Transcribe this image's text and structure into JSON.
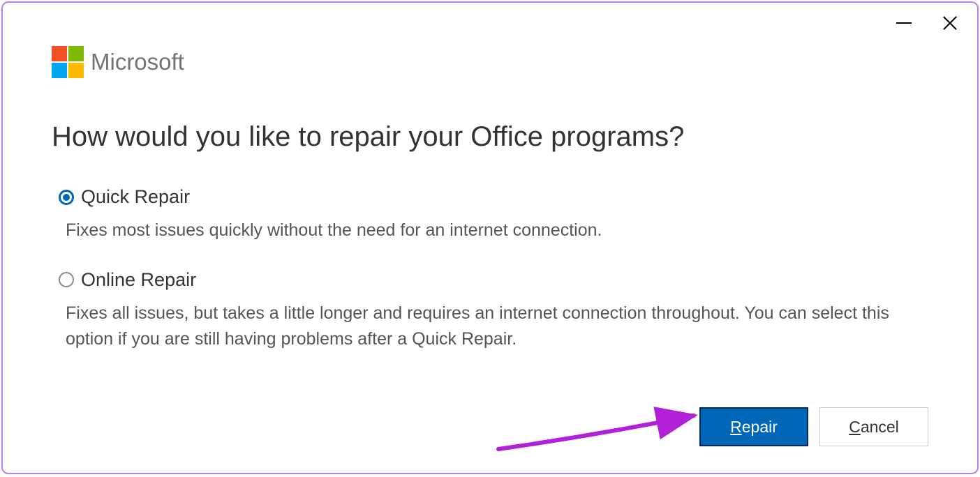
{
  "brand": "Microsoft",
  "heading": "How would you like to repair your Office programs?",
  "options": [
    {
      "label": "Quick Repair",
      "description": "Fixes most issues quickly without the need for an internet connection.",
      "selected": true
    },
    {
      "label": "Online Repair",
      "description": "Fixes all issues, but takes a little longer and requires an internet connection throughout. You can select this option if you are still having problems after a Quick Repair.",
      "selected": false
    }
  ],
  "buttons": {
    "repair_prefix": "R",
    "repair_rest": "epair",
    "cancel_prefix": "C",
    "cancel_rest": "ancel"
  }
}
